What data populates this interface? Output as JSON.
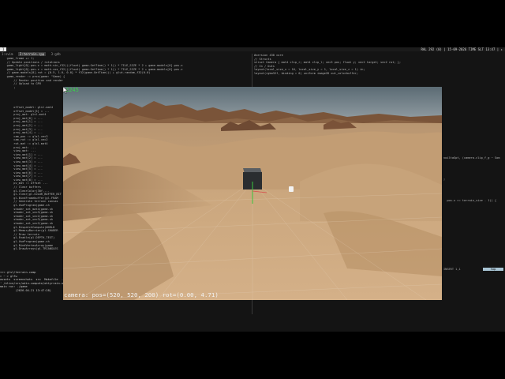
{
  "statusbar": {
    "workspace": "1",
    "right_text": "RAL 292 (0) | 15-09-2026 TIME SLT 13:47 | ▸"
  },
  "tmux": {
    "tabs": [
      {
        "label": "1:nvim",
        "active": false
      },
      {
        "label": "2:terrain.cpp",
        "active": true
      },
      {
        "label": "3:gdb",
        "active": false
      }
    ]
  },
  "left_code": [
    "    game_frame += 1;",
    "",
    "    // Update positions / rotations",
    "    game_light[0].pos.x = math.sin_f32(((float) game.GetTime() * 1)) * TILE_SIZE * 2 + game.models[0].pos.x",
    "    game_light[0].pos.z = math.cos_f32(((float) game.GetTime() * 1)) * TILE_SIZE * 2 + game.models[0].pos.z",
    "    // game.models[0].rot = {0.5, 1.0, 0.0} * f32(game.GetTime()) + glut.random_f32(0.0)",
    "",
    "",
    "    game_render := proc(game: ^Game) {",
    "        // Render position and render",
    "        // Upload to GPU",
    "        ;"
  ],
  "side_code": [
    "",
    "        offset_model: glsl.mat4",
    "        offset_model[3] = ...",
    "        proj_mat: glsl.mat4",
    "        proj_mat[0] = ...",
    "        proj_mat[1] = ...",
    "        proj_mat[2] = ...",
    "        proj_mat[3] = ...",
    "        proj_mat[4] = ...",
    "        cam_pos := glsl.vec3",
    "        cam_rot := glsl.vec2",
    "        rot_mat := glsl.mat4",
    "        proj_mat: ...",
    "        view_mat: ...",
    "        view_mat[1] = ...",
    "        view_mat[2] = ...",
    "        view_mat[3] = ...",
    "        view_mat[4] = ...",
    "        view_mat[5] = ...",
    "        view_mat[6] = ...",
    "        view_mat[7] = ...",
    "        view_mat[8] = ...",
    "        pv_mat := offset ...",
    "",
    "        // Clear buffers",
    "        gl.ClearColor(30f,...",
    "        gl.Clear(gl.COLOR_BUFFER_BIT",
    "        gl.BindFramebuffer(gl.FRAM",
    "",
    "        // Generate terrain canvas",
    "        gl.UseProgram(game.sh",
    "        shader_set_mat4(game.sh",
    "        shader_set_vec3(game.sh",
    "        shader_set_vec2(game.sh",
    "        shader_set_vec3(game.sh",
    "        shader_set_vec2(game.sh",
    "        gl.DispatchCompute(WORLD",
    "        gl.MemoryBarrier(gl.SHADER",
    "",
    "        // Draw terrain",
    "        gl.Enable(gl.DEPTH_TEST)",
    "        gl.UseProgram(game.sh",
    "        gl.BindVertexArray(game",
    "        gl.DrawArrays(gl.TRIANGLES"
  ],
  "right_code": [
    "#version 430 core",
    "",
    "// Structs",
    "struct Camera { mat4 clip_r; mat4 clip_l; vec3 pos; float y; vec2 target; vec2 rot; };",
    "",
    "// In / Outs",
    "layout(local_size_x = 16, local_size_y = 1, local_size_z = 1) in;",
    "layout(rgba32f, binding = 0) uniform image2D out_colorbuffer;"
  ],
  "right_fragments": [
    "voiltaSpt, (camera.clip_f_g ~ Som",
    ";",
    "  pos.x >= terrain_size - 1)) {"
  ],
  "terminal": {
    "lines": [
      "<<< glsl/terrain.comp",
      "",
      "> ~ > glfw",
      "assets  screenshots  src  Makefile  .odin",
      "' /alice/src/odin-compute/ohtyrrain.odin(...) - had...",
      "main run: ./game",
      "         (2026-04-21 13:47:28)"
    ],
    "mode": "top",
    "cmd": "INSERT  1,1"
  },
  "game": {
    "fps": "2245",
    "camera_text": "camera: pos=(520, 520, 200) rot=(0.00, 4.71)",
    "colors": {
      "sky": "#6c7d86",
      "sand": "#c9a57c",
      "dune_shadow": "#a37d58",
      "rock": "#6e4a33",
      "cube": "#2a2d30",
      "axis_green": "#39c63e",
      "axis_red": "#d94a4a"
    }
  },
  "icons": {
    "cursor": "mouse-pointer-icon",
    "light": "light-marker-icon"
  }
}
